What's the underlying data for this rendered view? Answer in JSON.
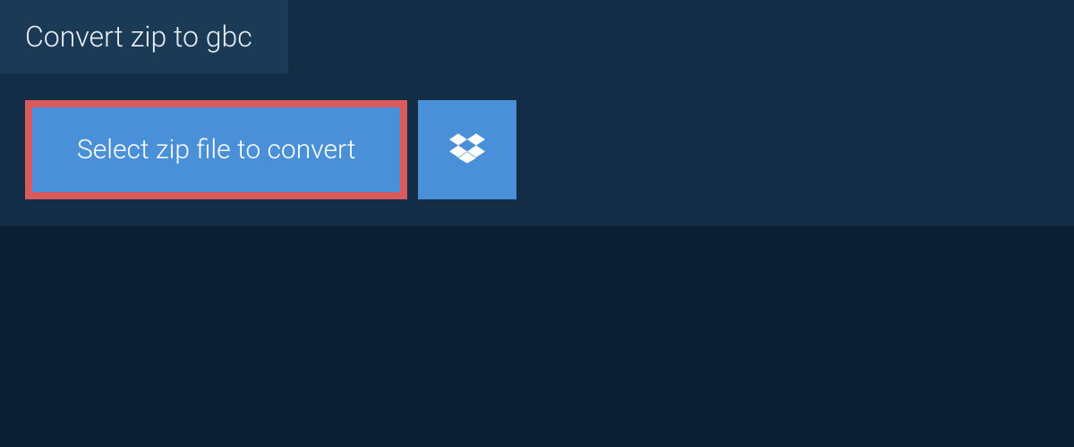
{
  "header": {
    "title": "Convert zip to gbc"
  },
  "actions": {
    "select_file_label": "Select zip file to convert"
  }
}
